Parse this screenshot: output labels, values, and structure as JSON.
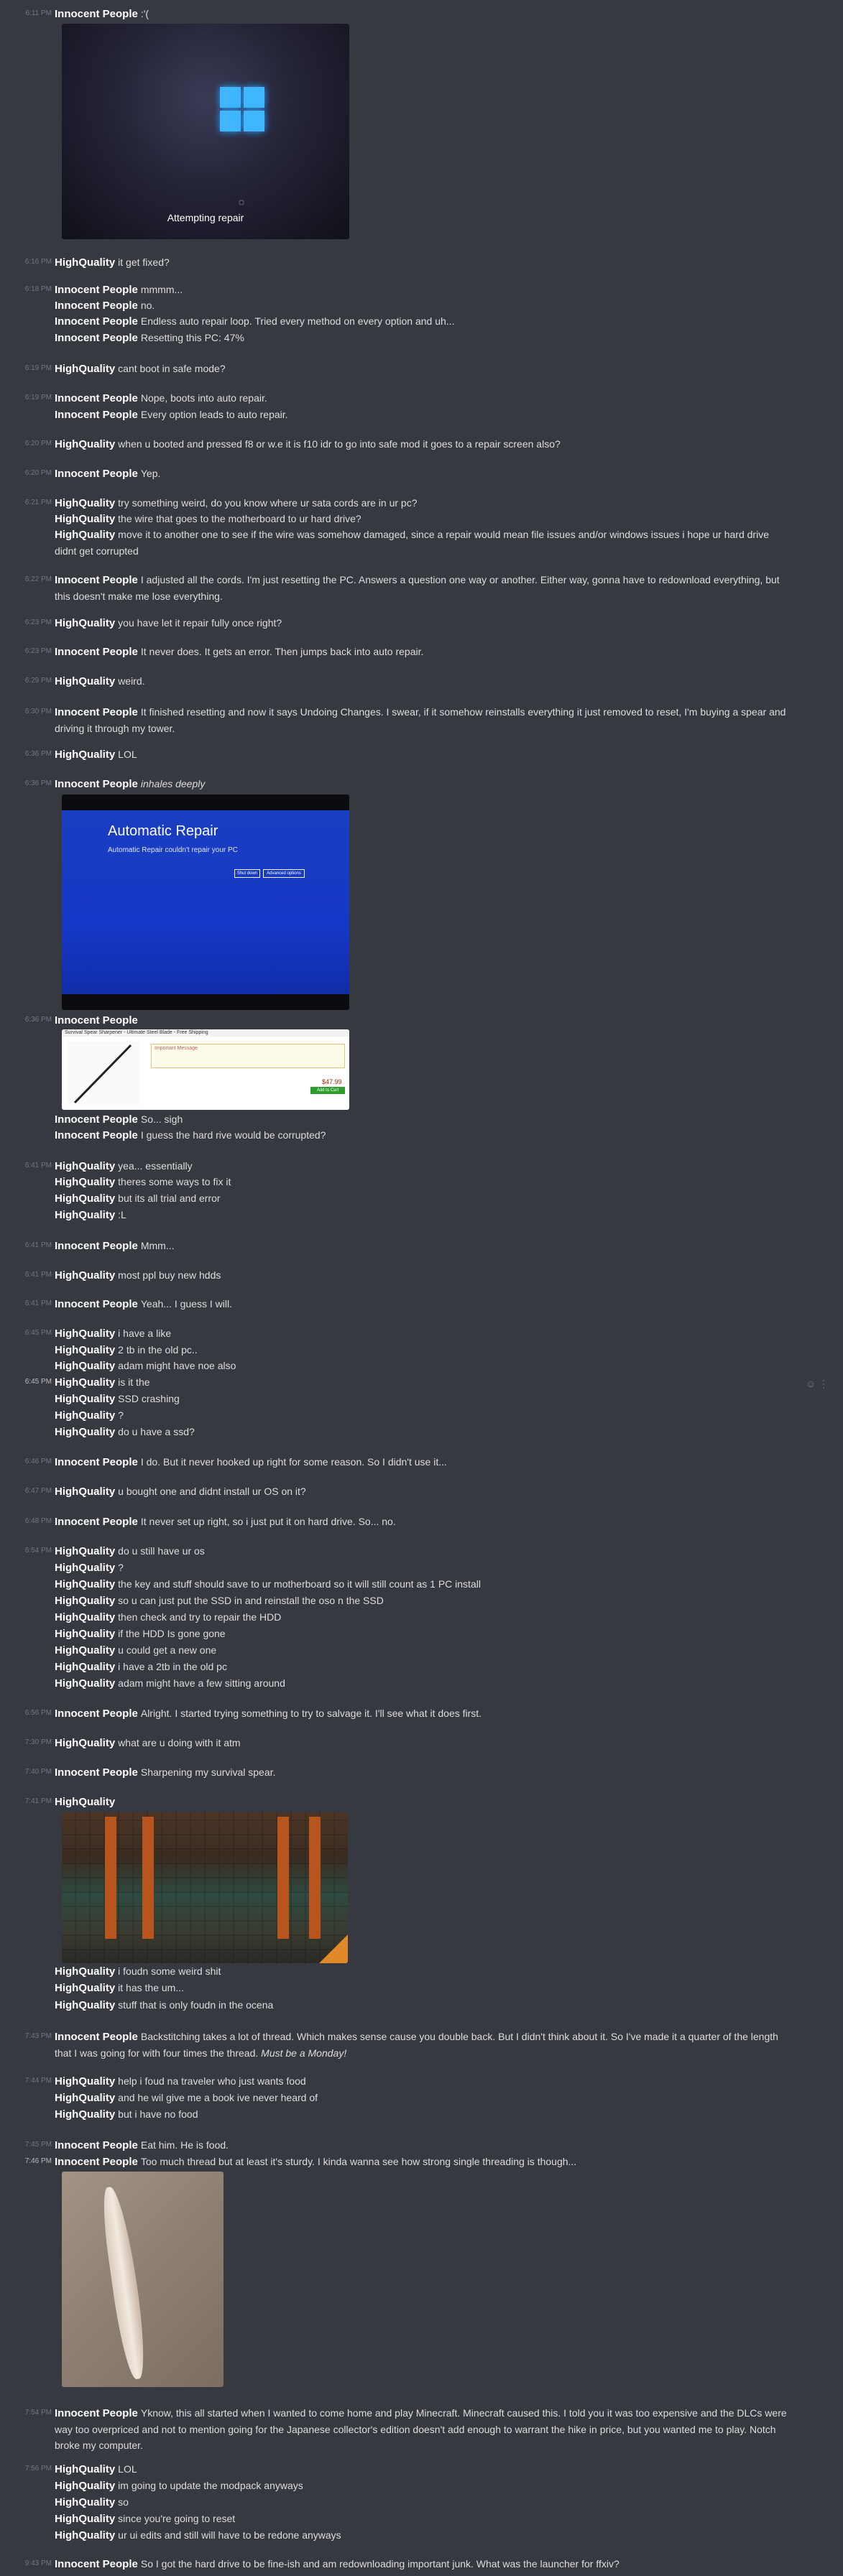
{
  "messages": [
    {
      "ts": "6:11 PM",
      "author": "Innocent People",
      "text": ":'("
    },
    {
      "attachment": "windows-repair-photo",
      "caption": "Attempting repair"
    },
    {
      "ts": "6:16 PM",
      "author": "HighQuality",
      "text": "it get fixed?"
    },
    {
      "ts": "6:18 PM",
      "author": "Innocent People",
      "text": "mmmm..."
    },
    {
      "author": "Innocent People",
      "text": "no."
    },
    {
      "author": "Innocent People",
      "text": "Endless auto repair loop. Tried every method on every option and uh..."
    },
    {
      "author": "Innocent People",
      "text": "Resetting this PC: 47%"
    },
    {
      "ts": "6:19 PM",
      "author": "HighQuality",
      "text": "cant boot in safe mode?"
    },
    {
      "ts": "6:19 PM",
      "author": "Innocent People",
      "text": "Nope, boots into auto repair."
    },
    {
      "author": "Innocent People",
      "text": "Every option leads to auto repair."
    },
    {
      "ts": "6:20 PM",
      "author": "HighQuality",
      "text": "when u booted and pressed f8 or w.e it is f10 idr to go into safe mod it goes to a repair screen also?"
    },
    {
      "ts": "6:20 PM",
      "author": "Innocent People",
      "text": "Yep."
    },
    {
      "ts": "6:21 PM",
      "author": "HighQuality",
      "text": "try something weird, do you know where ur sata cords are in ur pc?"
    },
    {
      "author": "HighQuality",
      "text": "the wire that goes to the motherboard to ur hard drive?"
    },
    {
      "author": "HighQuality",
      "text": "move it to another one to see if the wire was somehow damaged, since a repair would mean file issues and/or windows issues i hope ur hard drive didnt get corrupted"
    },
    {
      "ts": "6:22 PM",
      "author": "Innocent People",
      "text": "I adjusted all the cords. I'm just resetting the PC. Answers a question one way or another. Either way, gonna have to redownload everything, but this doesn't make me lose everything."
    },
    {
      "ts": "6:23 PM",
      "author": "HighQuality",
      "text": "you have let it repair fully once right?"
    },
    {
      "ts": "6:23 PM",
      "author": "Innocent People",
      "text": "It never does. It gets an error. Then jumps back into auto repair."
    },
    {
      "ts": "6:29 PM",
      "author": "HighQuality",
      "text": "weird."
    },
    {
      "ts": "6:30 PM",
      "author": "Innocent People",
      "text": "It finished resetting and now it says Undoing Changes. I swear, if it somehow reinstalls everything it just removed to reset, I'm buying a spear and driving it through my tower."
    },
    {
      "ts": "6:36 PM",
      "author": "HighQuality",
      "text": "LOL"
    },
    {
      "ts": "6:36 PM",
      "author": "Innocent People",
      "text": "inhales deeply"
    },
    {
      "attachment": "automatic-repair-photo",
      "title": "Automatic Repair",
      "subtitle": "Automatic Repair couldn't repair your PC",
      "btn1": "Shut down",
      "btn2": "Advanced options"
    },
    {
      "ts": "6:36 PM",
      "author": "Innocent People",
      "text": ""
    },
    {
      "attachment": "shopping-screenshot"
    },
    {
      "author": "Innocent People",
      "text": "So... sigh"
    },
    {
      "author": "Innocent People",
      "text": "I guess the hard rive would be corrupted?"
    },
    {
      "ts": "6:41 PM",
      "author": "HighQuality",
      "text": "yea... essentially"
    },
    {
      "author": "HighQuality",
      "text": "theres some ways to fix it"
    },
    {
      "author": "HighQuality",
      "text": "but its all trial and error"
    },
    {
      "author": "HighQuality",
      "text": ":L"
    },
    {
      "ts": "6:41 PM",
      "author": "Innocent People",
      "text": "Mmm..."
    },
    {
      "ts": "6:41 PM",
      "author": "HighQuality",
      "text": "most ppl buy new hdds"
    },
    {
      "ts": "6:41 PM",
      "author": "Innocent People",
      "text": "Yeah... I guess I will."
    },
    {
      "ts": "6:45 PM",
      "author": "HighQuality",
      "text": "i have a like"
    },
    {
      "author": "HighQuality",
      "text": "2 tb in the old pc.."
    },
    {
      "author": "HighQuality",
      "text": "adam might have noe also"
    },
    {
      "ts": "6:45 PM",
      "author": "HighQuality",
      "text": "is it the"
    },
    {
      "author": "HighQuality",
      "text": "SSD crashing"
    },
    {
      "author": "HighQuality",
      "text": "?"
    },
    {
      "author": "HighQuality",
      "text": "do u have a ssd?"
    },
    {
      "ts": "6:46 PM",
      "author": "Innocent People",
      "text": "I do. But it never hooked up right for some reason. So I didn't use it..."
    },
    {
      "ts": "6:47 PM",
      "author": "HighQuality",
      "text": "u bought one and didnt install ur OS on it?"
    },
    {
      "ts": "6:48 PM",
      "author": "Innocent People",
      "text": "It never set up right, so i just put it on hard drive. So... no."
    },
    {
      "ts": "6:54 PM",
      "author": "HighQuality",
      "text": "do u still have ur os"
    },
    {
      "author": "HighQuality",
      "text": "?"
    },
    {
      "author": "HighQuality",
      "text": "the key and stuff should save to ur motherboard so it will still count as 1 PC install"
    },
    {
      "author": "HighQuality",
      "text": "so u can just put the SSD in and reinstall the oso n the SSD"
    },
    {
      "author": "HighQuality",
      "text": "then check and try to repair the HDD"
    },
    {
      "author": "HighQuality",
      "text": "if the HDD Is gone gone"
    },
    {
      "author": "HighQuality",
      "text": "u could get a new one"
    },
    {
      "author": "HighQuality",
      "text": "i have a 2tb in the old pc"
    },
    {
      "author": "HighQuality",
      "text": "adam might have a few sitting around"
    },
    {
      "ts": "6:56 PM",
      "author": "Innocent People",
      "text": "Alright. I started trying something to try to salvage it. I'll see what it does first."
    },
    {
      "ts": "7:30 PM",
      "author": "HighQuality",
      "text": "what are u doing with it atm"
    },
    {
      "ts": "7:40 PM",
      "author": "Innocent People",
      "text": "Sharpening my survival spear."
    },
    {
      "ts": "7:41 PM",
      "author": "HighQuality",
      "text": ""
    },
    {
      "attachment": "minecraft-screenshot"
    },
    {
      "author": "HighQuality",
      "text": "i foudn some weird shit"
    },
    {
      "author": "HighQuality",
      "text": "it has the um..."
    },
    {
      "author": "HighQuality",
      "text": "stuff that is only foudn in the ocena"
    },
    {
      "ts": "7:43 PM",
      "author": "Innocent People",
      "text": "Backstitching takes a lot of thread. Which makes sense cause you double back. But I didn't think about it. So I've made it a quarter of the length that I was going for with four times the thread.",
      "em": "Must be a Monday!"
    },
    {
      "ts": "7:44 PM",
      "author": "HighQuality",
      "text": "help i foud na traveler who just wants food"
    },
    {
      "author": "HighQuality",
      "text": "and he wil give me a book ive never heard of"
    },
    {
      "author": "HighQuality",
      "text": "but i have no food"
    },
    {
      "ts": "7:45 PM",
      "author": "Innocent People",
      "text": "Eat him. He is food."
    },
    {
      "ts": "7:46 PM",
      "author": "Innocent People",
      "text": "Too much thread but at least it's sturdy. I kinda wanna see how strong single threading is though..."
    },
    {
      "attachment": "spear-photo"
    },
    {
      "ts": "7:54 PM",
      "author": "Innocent People",
      "text": "Yknow, this all started when I wanted to come home and play Minecraft. Minecraft caused this. I told you it was too expensive and the DLCs were way too overpriced and not to mention going for the Japanese collector's edition doesn't add enough to warrant the hike in price, but you wanted me to play. Notch broke my computer."
    },
    {
      "ts": "7:56 PM",
      "author": "HighQuality",
      "text": "LOL"
    },
    {
      "author": "HighQuality",
      "text": "im going to update the modpack anyways"
    },
    {
      "author": "HighQuality",
      "text": "so"
    },
    {
      "author": "HighQuality",
      "text": "since you're going to reset"
    },
    {
      "author": "HighQuality",
      "text": "ur ui edits and still will have to be redone anyways"
    },
    {
      "ts": "9:43 PM",
      "author": "Innocent People",
      "text": "So I got the hard drive to be fine-ish and am redownloading important junk. What was the launcher for ffxiv?"
    }
  ],
  "shop": {
    "title": "Survival Spear Sharpener - Ultimate Steel Blade - Free Shipping",
    "warning": "Important Message",
    "price": "$47.99",
    "button": "Add to Cart"
  },
  "colors": {
    "background": "#36393f",
    "text": "#dcddde",
    "author": "#ffffff",
    "timestamp": "#72767d",
    "windows_blue": "#3fb6ff"
  }
}
